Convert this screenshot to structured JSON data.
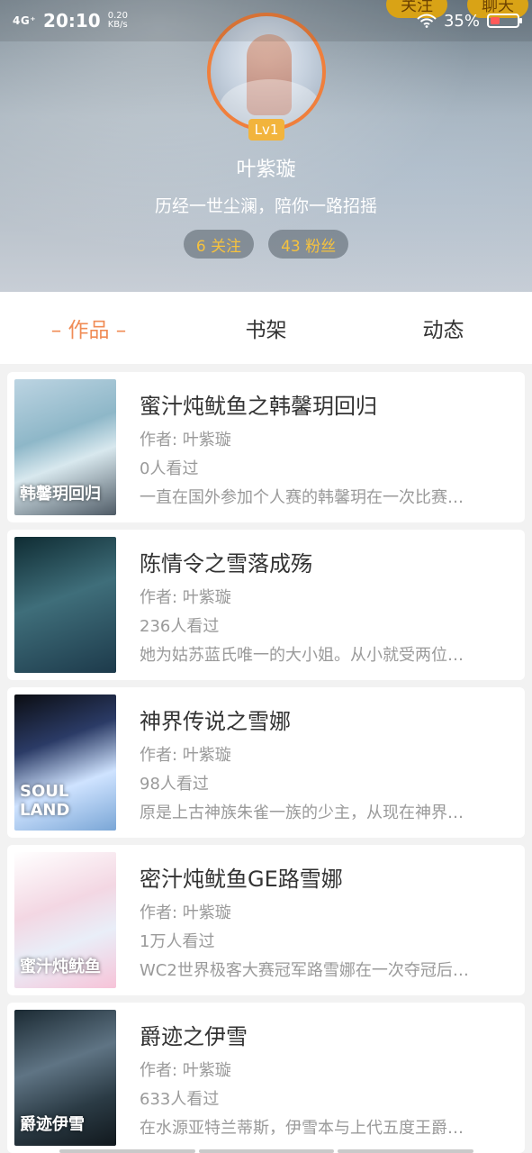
{
  "status_bar": {
    "signal": "4G⁺",
    "time": "20:10",
    "net_speed_value": "0.20",
    "net_speed_unit": "KB/s",
    "battery_percent_text": "35%",
    "battery_level": 0.35,
    "battery_color": "#ff5a5a"
  },
  "top_actions": {
    "follow": "关注",
    "chat": "聊天"
  },
  "profile": {
    "level": "Lv1",
    "name": "叶紫璇",
    "bio": "历经一世尘澜，陪你一路招摇",
    "following": "6 关注",
    "followers": "43 粉丝"
  },
  "tabs": [
    {
      "label": "– 作品 –",
      "active": true
    },
    {
      "label": "书架",
      "active": false
    },
    {
      "label": "动态",
      "active": false
    }
  ],
  "books": [
    {
      "title": "蜜汁炖鱿鱼之韩馨玥回归",
      "author": "作者: 叶紫璇",
      "views": "0人看过",
      "desc": "一直在国外参加个人赛的韩馨玥在一次比赛…",
      "cover_text": "韩馨玥回归"
    },
    {
      "title": "陈情令之雪落成殇",
      "author": "作者: 叶紫璇",
      "views": "236人看过",
      "desc": "她为姑苏蓝氏唯一的大小姐。从小就受两位…",
      "cover_text": ""
    },
    {
      "title": "神界传说之雪娜",
      "author": "作者: 叶紫璇",
      "views": "98人看过",
      "desc": "原是上古神族朱雀一族的少主，从现在神界…",
      "cover_text": "SOUL LAND"
    },
    {
      "title": "密汁炖鱿鱼GE路雪娜",
      "author": "作者: 叶紫璇",
      "views": "1万人看过",
      "desc": "WC2世界极客大赛冠军路雪娜在一次夺冠后…",
      "cover_text": "蜜汁炖鱿鱼"
    },
    {
      "title": "爵迹之伊雪",
      "author": "作者: 叶紫璇",
      "views": "633人看过",
      "desc": "在水源亚特兰蒂斯，伊雪本与上代五度王爵…",
      "cover_text": "爵迹伊雪"
    }
  ],
  "colors": {
    "accent": "#f08c56",
    "badge": "#f2b43c",
    "stat_text": "#f6c23e",
    "avatar_ring": "#f07f3c"
  }
}
